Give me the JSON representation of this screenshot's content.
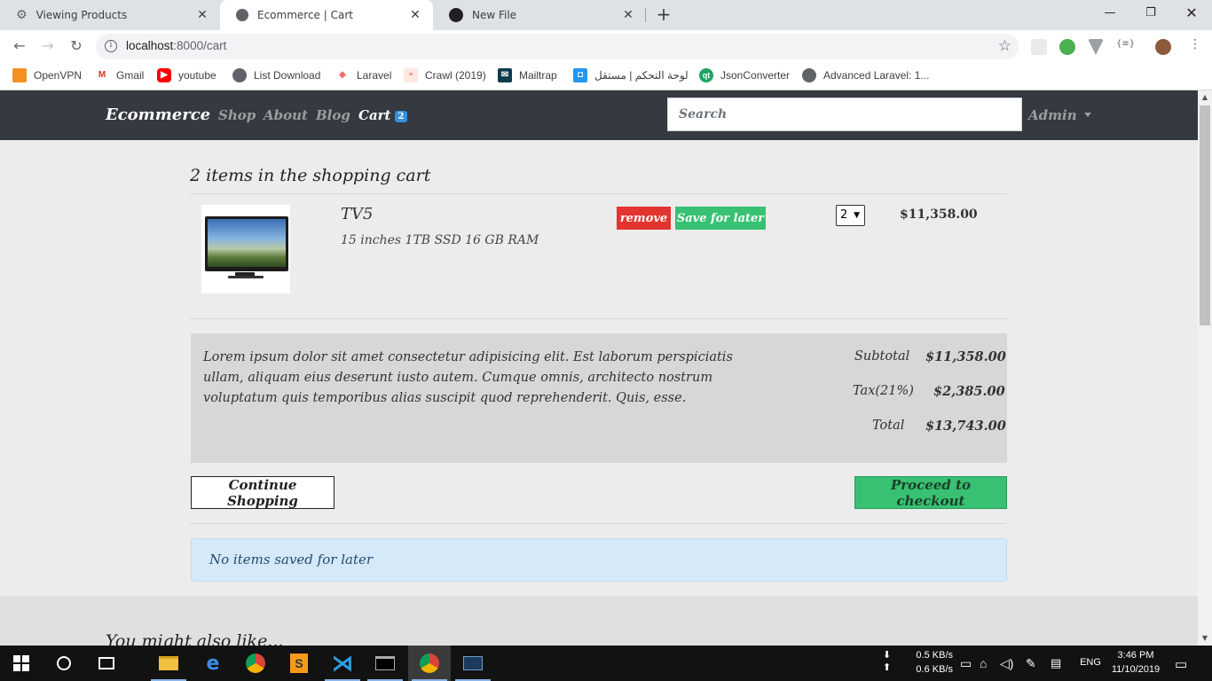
{
  "browser": {
    "tabs": [
      {
        "title": "Viewing Products",
        "icon": "gear-icon"
      },
      {
        "title": "Ecommerce | Cart",
        "icon": "globe-icon"
      },
      {
        "title": "New File",
        "icon": "github-icon"
      }
    ],
    "address": {
      "host": "localhost",
      "path": ":8000/cart"
    },
    "bookmarks": [
      {
        "label": "OpenVPN",
        "color": "#f29020"
      },
      {
        "label": "Gmail",
        "color": "#d93025"
      },
      {
        "label": "youtube",
        "color": "#ff0000"
      },
      {
        "label": "List Download",
        "color": "#5f6368"
      },
      {
        "label": "Laravel",
        "color": "#f4645f"
      },
      {
        "label": "Crawl (2019)",
        "color": "#e64a19"
      },
      {
        "label": "Mailtrap",
        "color": "#0f3b4f"
      },
      {
        "label": "لوحة التحكم | مستقل",
        "color": "#2196f3"
      },
      {
        "label": "JsonConverter",
        "color": "#1ea362"
      },
      {
        "label": "Advanced Laravel: 1...",
        "color": "#5f6368"
      }
    ]
  },
  "nav": {
    "brand": "Ecommerce",
    "links": [
      "Shop",
      "About",
      "Blog"
    ],
    "cart_label": "Cart",
    "cart_count": "2",
    "search_placeholder": "Search",
    "user": "Admin"
  },
  "cart": {
    "heading": "2 items in the shopping cart",
    "items": [
      {
        "name": "TV5",
        "details": "15 inches 1TB SSD 16 GB RAM",
        "remove_label": "remove",
        "save_label": "Save for later",
        "quantity": "2",
        "price": "$11,358.00"
      }
    ],
    "summary": {
      "text": "Lorem ipsum dolor sit amet consectetur adipisicing elit. Est laborum perspiciatis ullam, aliquam eius deserunt iusto autem. Cumque omnis, architecto nostrum voluptatum quis temporibus alias suscipit quod reprehenderit. Quis, esse.",
      "subtotal_label": "Subtotal",
      "subtotal": "$11,358.00",
      "tax_label": "Tax(21%)",
      "tax": "$2,385.00",
      "total_label": "Total",
      "total": "$13,743.00"
    },
    "continue_label": "Continue Shopping",
    "checkout_label": "Proceed to checkout",
    "saved_for_later_message": "No items saved for later",
    "also_like_heading": "You might also like..."
  },
  "taskbar": {
    "net_down": "0.5 KB/s",
    "net_up": "0.6 KB/s",
    "language": "ENG",
    "time": "3:46 PM",
    "date": "11/10/2019"
  },
  "colors": {
    "navbar": "#343a40",
    "danger": "#e3342f",
    "success": "#38c172",
    "info_bg": "#d6e9f8"
  }
}
